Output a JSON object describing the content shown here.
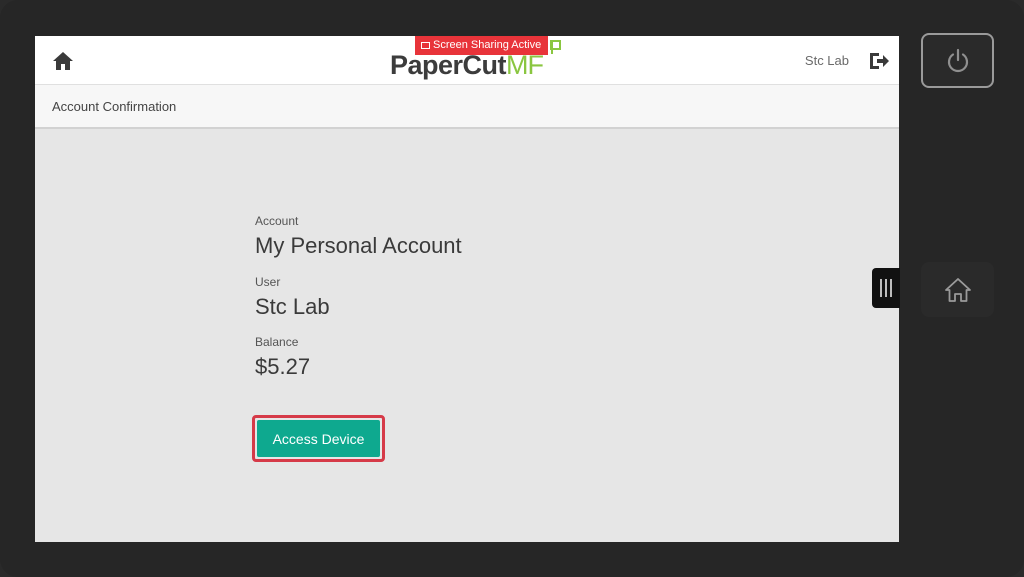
{
  "header": {
    "screen_sharing_badge": "Screen Sharing Active",
    "logo_main": "PaperCut",
    "logo_accent": "MF",
    "user_name": "Stc Lab"
  },
  "subheader": {
    "title": "Account Confirmation"
  },
  "details": {
    "account_label": "Account",
    "account_value": "My Personal Account",
    "user_label": "User",
    "user_value": "Stc Lab",
    "balance_label": "Balance",
    "balance_value": "$5.27"
  },
  "actions": {
    "access_device_label": "Access Device"
  },
  "icons": {
    "home": "home-icon",
    "logout": "logout-icon",
    "power": "power-icon",
    "hardware_home": "home-outline-icon",
    "side_handle": "menu-handle-icon"
  },
  "colors": {
    "accent_green": "#0ea98f",
    "highlight_red": "#d63a48",
    "badge_red": "#e8343a",
    "logo_green": "#8ac640"
  }
}
